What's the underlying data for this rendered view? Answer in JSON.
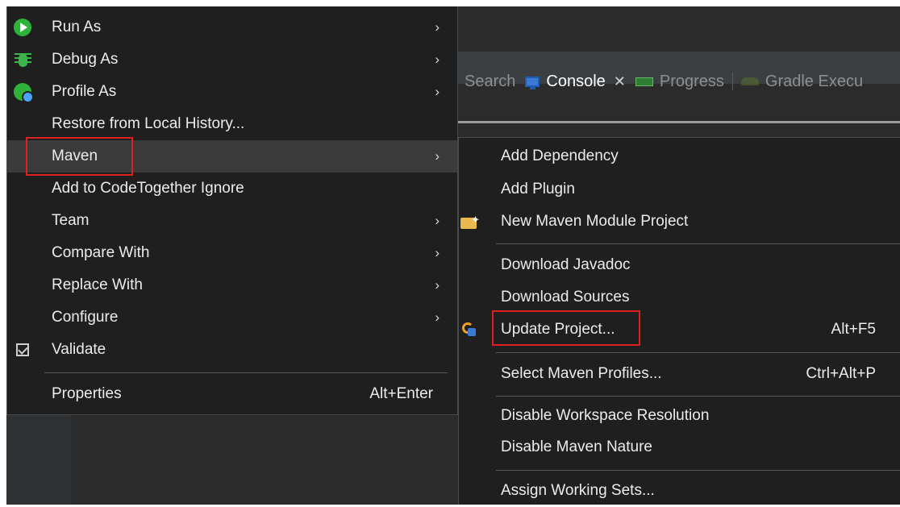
{
  "tabs": [
    {
      "label": "Search",
      "icon": "none",
      "active": false
    },
    {
      "label": "Console",
      "icon": "console-icon",
      "active": true,
      "closable": true
    },
    {
      "label": "Progress",
      "icon": "progress-icon",
      "active": false
    },
    {
      "label": "Gradle Execu",
      "icon": "gradle-icon",
      "active": false
    }
  ],
  "context_menu": {
    "items": [
      {
        "label": "Run As",
        "icon": "run-icon",
        "submenu": true
      },
      {
        "label": "Debug As",
        "icon": "bug-icon",
        "submenu": true
      },
      {
        "label": "Profile As",
        "icon": "profile-icon",
        "submenu": true
      },
      {
        "label": "Restore from Local History...",
        "icon": "",
        "submenu": false
      },
      {
        "label": "Maven",
        "icon": "",
        "submenu": true,
        "highlighted": true
      },
      {
        "label": "Add to CodeTogether Ignore",
        "icon": "",
        "submenu": false
      },
      {
        "label": "Team",
        "icon": "",
        "submenu": true
      },
      {
        "label": "Compare With",
        "icon": "",
        "submenu": true
      },
      {
        "label": "Replace With",
        "icon": "",
        "submenu": true
      },
      {
        "label": "Configure",
        "icon": "",
        "submenu": true
      },
      {
        "label": "Validate",
        "icon": "checkbox-icon",
        "submenu": false
      },
      {
        "label": "Properties",
        "icon": "",
        "accelerator": "Alt+Enter"
      }
    ]
  },
  "maven_submenu": {
    "items": [
      {
        "label": "Add Dependency",
        "icon": ""
      },
      {
        "label": "Add Plugin",
        "icon": ""
      },
      {
        "label": "New Maven Module Project",
        "icon": "module-icon"
      },
      {
        "label": "Download Javadoc",
        "icon": ""
      },
      {
        "label": "Download Sources",
        "icon": ""
      },
      {
        "label": "Update Project...",
        "icon": "update-icon",
        "accelerator": "Alt+F5"
      },
      {
        "label": "Select Maven Profiles...",
        "icon": "",
        "accelerator": "Ctrl+Alt+P"
      },
      {
        "label": "Disable Workspace Resolution",
        "icon": ""
      },
      {
        "label": "Disable Maven Nature",
        "icon": ""
      },
      {
        "label": "Assign Working Sets...",
        "icon": ""
      }
    ]
  },
  "highlight_color": "#e02020"
}
